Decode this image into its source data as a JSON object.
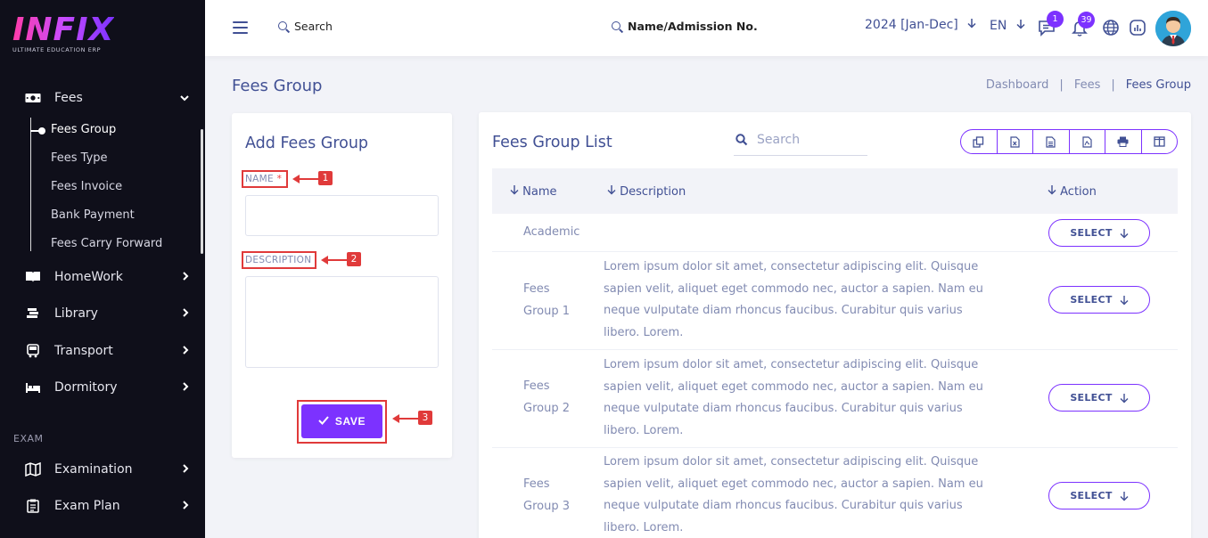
{
  "sidebar": {
    "logo_text": "INFIX",
    "logo_sub": "ULTIMATE EDUCATION ERP",
    "fees": {
      "label": "Fees",
      "icon": "money-icon"
    },
    "fees_sub": [
      {
        "label": "Fees Group"
      },
      {
        "label": "Fees Type"
      },
      {
        "label": "Fees Invoice"
      },
      {
        "label": "Bank Payment"
      },
      {
        "label": "Fees Carry Forward"
      }
    ],
    "items": [
      {
        "label": "HomeWork",
        "icon": "book-icon"
      },
      {
        "label": "Library",
        "icon": "library-icon"
      },
      {
        "label": "Transport",
        "icon": "bus-icon"
      },
      {
        "label": "Dormitory",
        "icon": "bed-icon"
      }
    ],
    "section_exam": "EXAM",
    "exam_items": [
      {
        "label": "Examination",
        "icon": "map-icon"
      },
      {
        "label": "Exam Plan",
        "icon": "clipboard-icon"
      }
    ]
  },
  "topbar": {
    "search_label": "Search",
    "student_search_label": "Name/Admission No.",
    "session": "2024 [Jan-Dec]",
    "language": "EN",
    "chat_badge": "1",
    "notification_badge": "39"
  },
  "page": {
    "title": "Fees Group",
    "breadcrumb": [
      "Dashboard",
      "Fees",
      "Fees Group"
    ]
  },
  "form": {
    "title": "Add Fees Group",
    "name_label": "NAME",
    "name_required": "*",
    "description_label": "DESCRIPTION",
    "save_label": "SAVE",
    "annotations": [
      "1",
      "2",
      "3"
    ]
  },
  "list": {
    "title": "Fees Group List",
    "search_placeholder": "Search",
    "columns": [
      "Name",
      "Description",
      "Action"
    ],
    "select_label": "SELECT",
    "rows": [
      {
        "name": "Academic",
        "name2": "",
        "description": ""
      },
      {
        "name": "Fees",
        "name2": "Group 1",
        "description": "Lorem ipsum dolor sit amet, consectetur adipiscing elit. Quisque sapien velit, aliquet eget commodo nec, auctor a sapien. Nam eu neque vulputate diam rhoncus faucibus. Curabitur quis varius libero. Lorem."
      },
      {
        "name": "Fees",
        "name2": "Group 2",
        "description": "Lorem ipsum dolor sit amet, consectetur adipiscing elit. Quisque sapien velit, aliquet eget commodo nec, auctor a sapien. Nam eu neque vulputate diam rhoncus faucibus. Curabitur quis varius libero. Lorem."
      },
      {
        "name": "Fees",
        "name2": "Group 3",
        "description": "Lorem ipsum dolor sit amet, consectetur adipiscing elit. Quisque sapien velit, aliquet eget commodo nec, auctor a sapien. Nam eu neque vulputate diam rhoncus faucibus. Curabitur quis varius libero. Lorem."
      }
    ]
  },
  "colors": {
    "accent": "#7c32ff",
    "primary_text": "#415094",
    "muted_text": "#828bb2",
    "sidebar_bg": "#0f0f1a",
    "annotation_red": "#e03a3a"
  }
}
